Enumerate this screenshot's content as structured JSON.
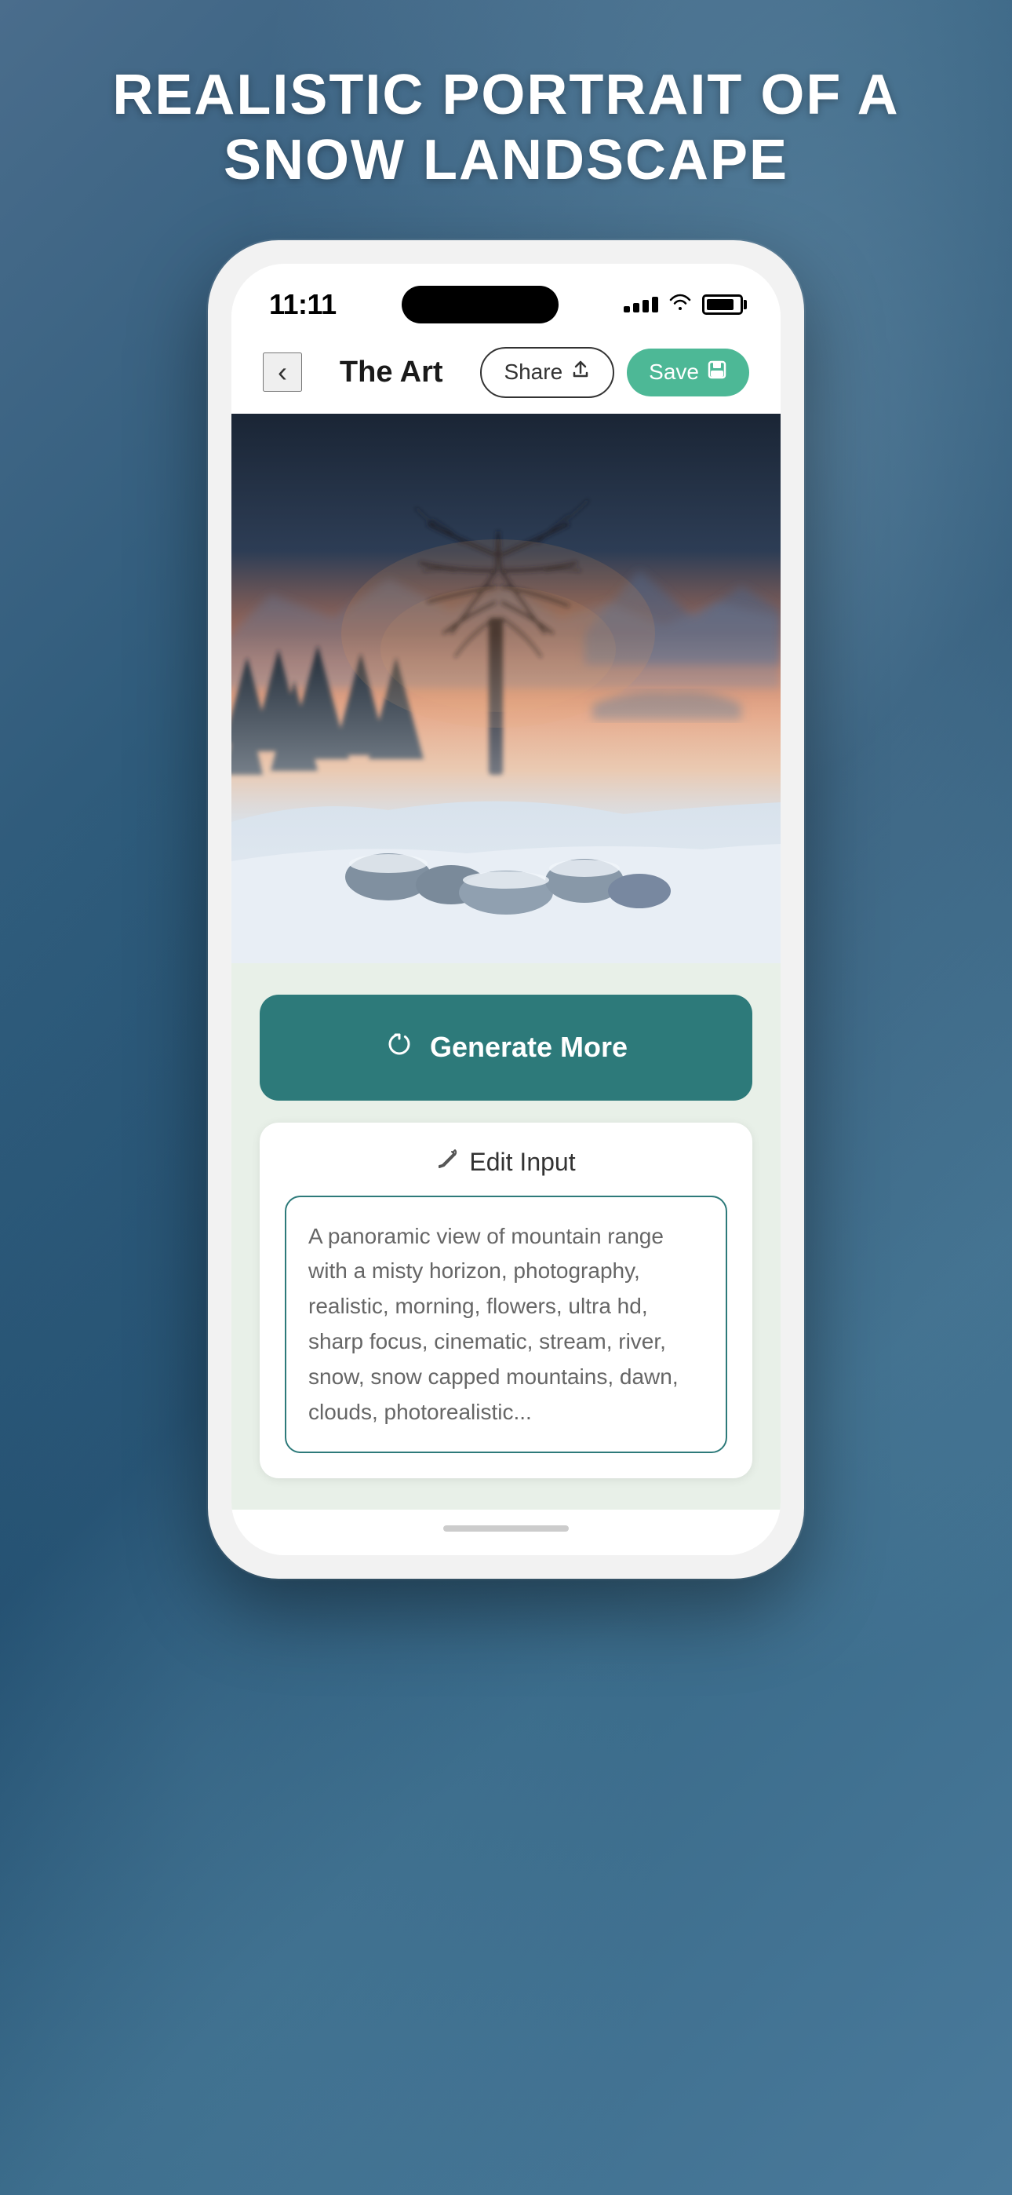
{
  "page": {
    "title": "REALISTIC PORTRAIT OF A\nSNOW LANDSCAPE"
  },
  "statusBar": {
    "time": "11:11",
    "signalLabel": "signal",
    "wifiLabel": "wifi",
    "batteryLabel": "battery"
  },
  "navbar": {
    "backLabel": "‹",
    "title": "The Art",
    "shareLabel": "Share",
    "saveLabel": "Save"
  },
  "image": {
    "altText": "Realistic portrait of a snow landscape with misty trees and orange sky"
  },
  "generateBtn": {
    "label": "Generate More",
    "iconLabel": "refresh-icon"
  },
  "editInput": {
    "sectionLabel": "Edit Input",
    "textValue": "A panoramic view of mountain range with a misty horizon, photography, realistic, morning, flowers, ultra hd, sharp focus, cinematic, stream, river, snow, snow capped mountains, dawn, clouds, photorealistic..."
  }
}
